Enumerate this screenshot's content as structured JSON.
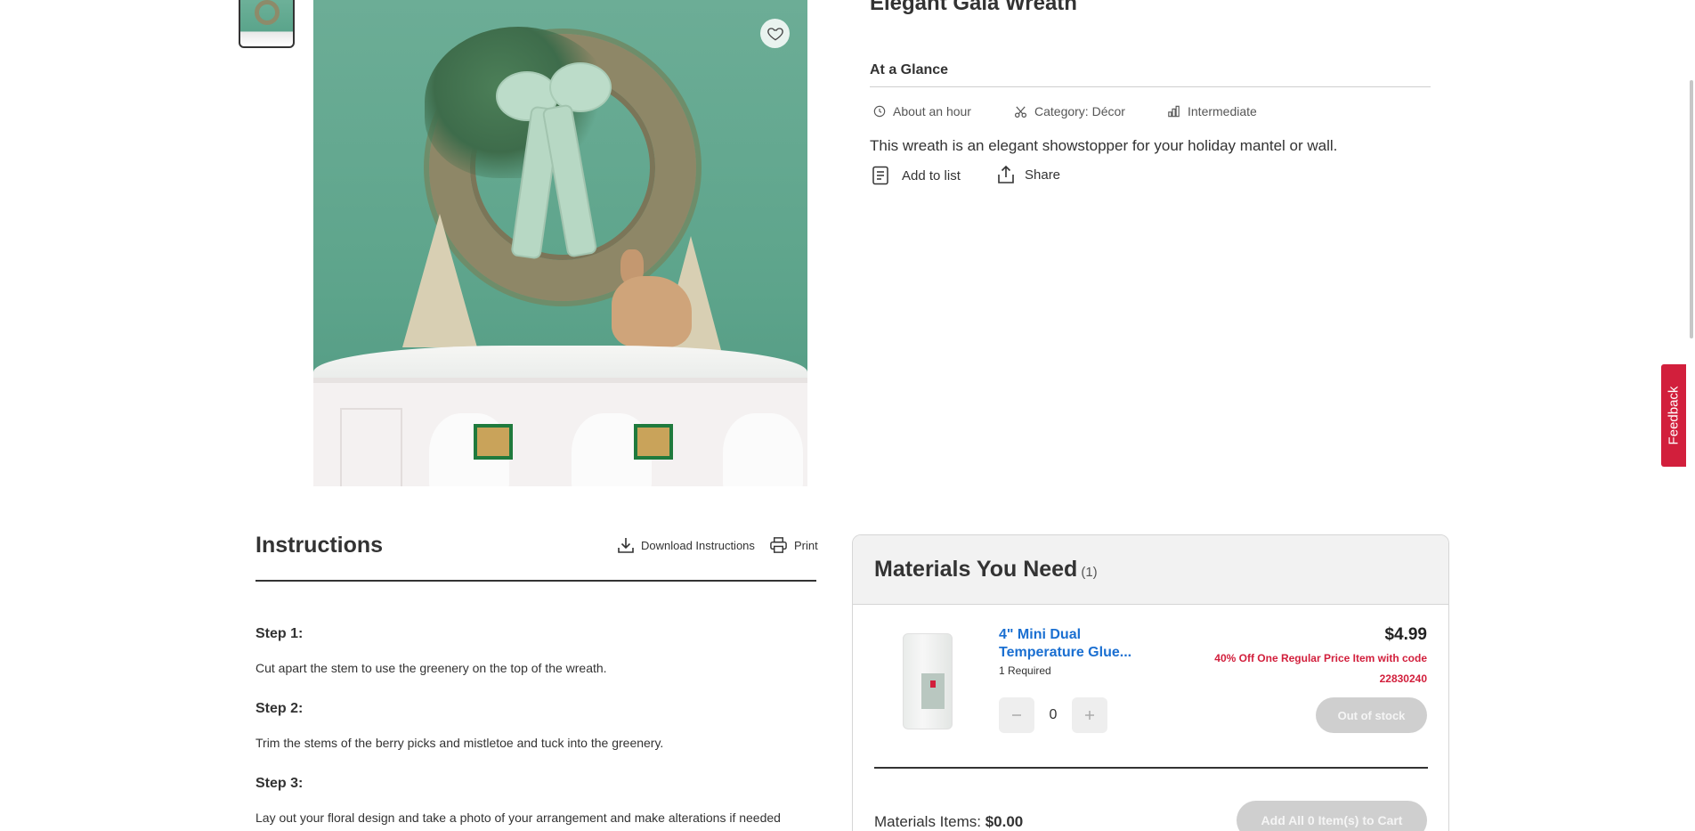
{
  "project": {
    "title": "Elegant Gala Wreath",
    "description": "This wreath is an elegant showstopper for your holiday mantel or wall."
  },
  "glance": {
    "heading": "At a Glance",
    "time": "About an hour",
    "category": "Category: Décor",
    "skill": "Intermediate"
  },
  "actions": {
    "add_to_list": "Add to list",
    "share": "Share"
  },
  "feedback": {
    "label": "Feedback"
  },
  "instructions": {
    "heading": "Instructions",
    "download_label": "Download Instructions",
    "print_label": "Print",
    "steps": [
      {
        "label": "Step 1:",
        "text": "Cut apart the stem to use the greenery on the top of the wreath."
      },
      {
        "label": "Step 2:",
        "text": "Trim the stems of the berry picks and mistletoe and tuck into the greenery."
      },
      {
        "label": "Step 3:",
        "text": "Lay out your floral design and take a photo of your arrangement and make alterations if needed"
      }
    ]
  },
  "materials": {
    "heading": "Materials You Need",
    "count": "(1)",
    "items": [
      {
        "name": "4\" Mini Dual Temperature Glue...",
        "required": "1 Required",
        "price": "$4.99",
        "promo": "40% Off One Regular Price Item with code 22830240",
        "quantity": "0",
        "stock_button": "Out of stock"
      }
    ],
    "total_label": "Materials Items:",
    "total_value": "$0.00",
    "add_all_label": "Add All 0 Item(s) to Cart"
  },
  "icons": {
    "favorite": "heart-icon",
    "time": "clock-icon",
    "category": "scissors-icon",
    "skill": "bar-chart-icon",
    "list": "document-icon",
    "share": "share-icon",
    "download": "download-icon",
    "print": "printer-icon"
  },
  "colors": {
    "accent_red": "#d21f3c",
    "link_blue": "#1a6fd1",
    "disabled_gray": "#cfcfcf"
  }
}
